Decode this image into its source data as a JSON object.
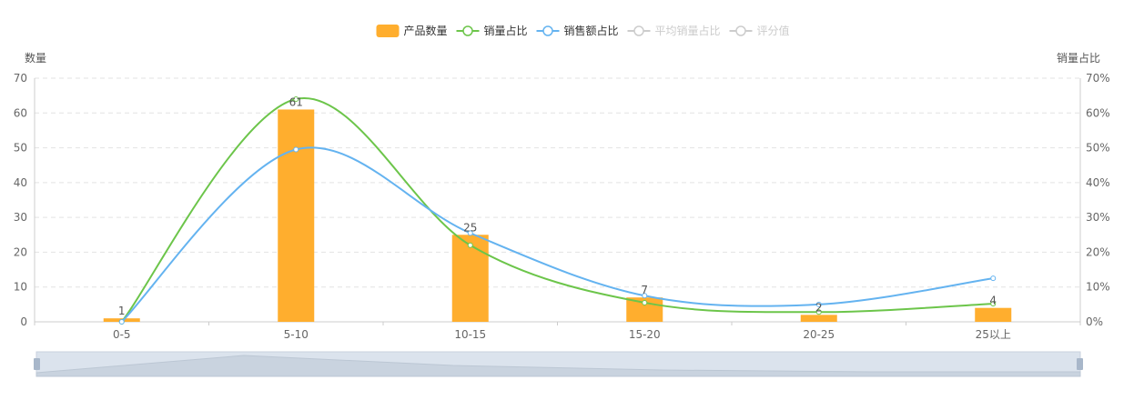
{
  "chart_data": {
    "type": "bar",
    "categories": [
      "0-5",
      "5-10",
      "10-15",
      "15-20",
      "20-25",
      "25以上"
    ],
    "y_left": {
      "label": "数量",
      "ylim": [
        0,
        70
      ],
      "ticks": [
        0,
        10,
        20,
        30,
        40,
        50,
        60,
        70
      ]
    },
    "y_right": {
      "label": "销量占比",
      "ylim": [
        0,
        70
      ],
      "unit": "%",
      "ticks": [
        "0%",
        "10%",
        "20%",
        "30%",
        "40%",
        "50%",
        "60%",
        "70%"
      ]
    },
    "series": [
      {
        "name": "产品数量",
        "type": "bar",
        "color": "#FFAE2E",
        "values": [
          1,
          61,
          25,
          7,
          2,
          4
        ],
        "labels": [
          "1",
          "61",
          "25",
          "7",
          "2",
          "4"
        ]
      },
      {
        "name": "销量占比",
        "type": "line",
        "color": "#6CC54A",
        "values": [
          0,
          64,
          22,
          5.5,
          2.8,
          5.2
        ]
      },
      {
        "name": "销售额占比",
        "type": "line",
        "color": "#64B3F0",
        "values": [
          0,
          49.5,
          25.5,
          7.5,
          5,
          12.5
        ]
      },
      {
        "name": "平均销量占比",
        "type": "line",
        "color": "#CCCCCC",
        "hidden": true
      },
      {
        "name": "评分值",
        "type": "line",
        "color": "#CCCCCC",
        "hidden": true
      }
    ],
    "grid": true,
    "legend": "top-center",
    "data_zoom": {
      "start": 0,
      "end": 100
    }
  }
}
